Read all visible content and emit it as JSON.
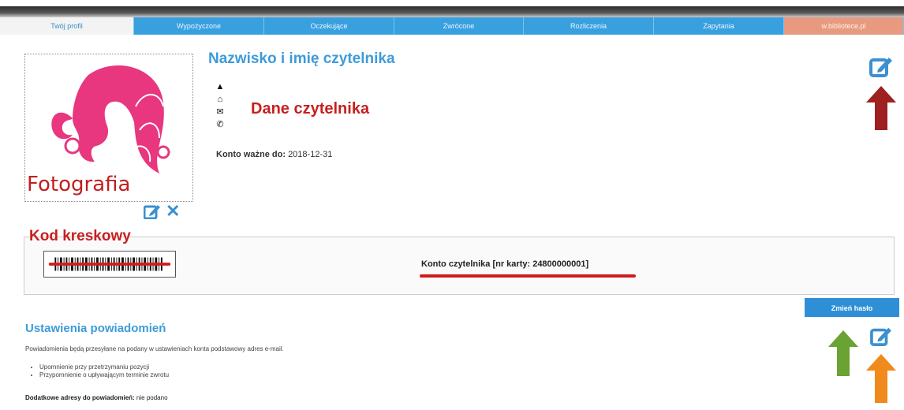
{
  "tabs": [
    {
      "label": "Twój profil",
      "active": true
    },
    {
      "label": "Wypożyczone"
    },
    {
      "label": "Oczekujące"
    },
    {
      "label": "Zwrócone"
    },
    {
      "label": "Rozliczenia"
    },
    {
      "label": "Zapytania"
    },
    {
      "label": "w.bibliotece.pl",
      "external": true
    }
  ],
  "profile": {
    "reader_name": "Nazwisko i imię czytelnika",
    "data_annotation": "Dane czytelnika",
    "valid_label": "Konto ważne do:",
    "valid_date": "2018-12-31",
    "photo_annotation": "Fotografia"
  },
  "contact_icons": [
    "user-icon",
    "home-icon",
    "envelope-icon",
    "phone-icon"
  ],
  "barcode": {
    "annotation": "Kod kreskowy",
    "card_text": "Konto czytelnika [nr karty: 24800000001]"
  },
  "buttons": {
    "change_password": "Zmień hasło"
  },
  "notifications": {
    "title": "Ustawienia powiadomień",
    "description": "Powiadomienia będą przesyłane na podany w ustawieniach konta podstawowy adres e-mail.",
    "options": [
      "Upomnienie przy przetrzymaniu pozycji",
      "Przypomnienie o upływającym terminie zwrotu"
    ],
    "extra_label": "Dodatkowe adresy do powiadomień:",
    "extra_value": "nie podano"
  },
  "colors": {
    "accent": "#3d9bd9",
    "annotation": "#c81f1f",
    "arrow_red": "#9e2020",
    "arrow_green": "#6aa233",
    "arrow_orange": "#f08a1c"
  }
}
